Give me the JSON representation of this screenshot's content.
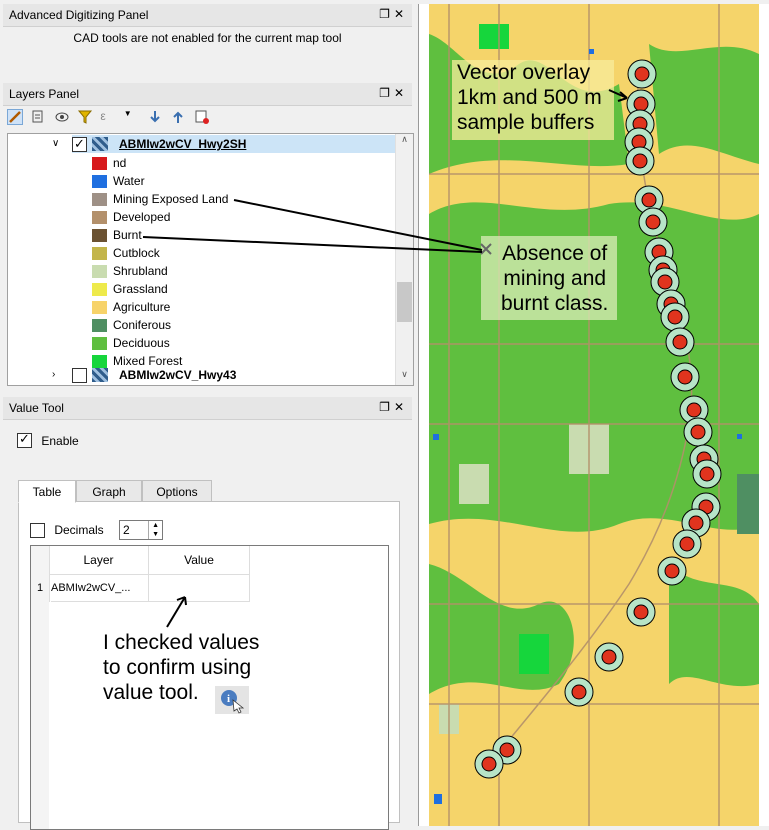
{
  "adv_panel": {
    "title": "Advanced Digitizing Panel",
    "message": "CAD tools are not enabled for the current map tool"
  },
  "layers_panel": {
    "title": "Layers Panel",
    "layer1": {
      "name": "ABMIw2wCV_Hwy2SH",
      "checked": true
    },
    "legend": [
      {
        "label": "nd",
        "color": "#d7191c"
      },
      {
        "label": "Water",
        "color": "#1f6fe0"
      },
      {
        "label": "Mining Exposed Land",
        "color": "#9e9086"
      },
      {
        "label": "Developed",
        "color": "#b3906b"
      },
      {
        "label": "Burnt",
        "color": "#6b5232"
      },
      {
        "label": "Cutblock",
        "color": "#c3b54a"
      },
      {
        "label": "Shrubland",
        "color": "#c9dcb0"
      },
      {
        "label": "Grassland",
        "color": "#eeea4b"
      },
      {
        "label": "Agriculture",
        "color": "#f7d36a"
      },
      {
        "label": "Coniferous",
        "color": "#4f8f62"
      },
      {
        "label": "Deciduous",
        "color": "#5fbf3f"
      },
      {
        "label": "Mixed Forest",
        "color": "#16d63c"
      }
    ],
    "layer2": {
      "name": "ABMIw2wCV_Hwy43",
      "checked": false
    }
  },
  "value_tool": {
    "title": "Value Tool",
    "enable_label": "Enable",
    "tabs": [
      "Table",
      "Graph",
      "Options"
    ],
    "decimals_label": "Decimals",
    "decimals_value": "2",
    "columns": [
      "Layer",
      "Value"
    ],
    "rows": [
      {
        "num": "1",
        "layer": "ABMIw2wCV_...",
        "value": ""
      }
    ]
  },
  "annotations": {
    "vector_overlay": [
      "Vector overlay",
      "1km and 500 m",
      "sample  buffers"
    ],
    "absence": [
      "Absence of",
      "mining and",
      "burnt class."
    ],
    "checked_values": [
      "I checked values",
      "to confirm using",
      "value tool."
    ]
  }
}
